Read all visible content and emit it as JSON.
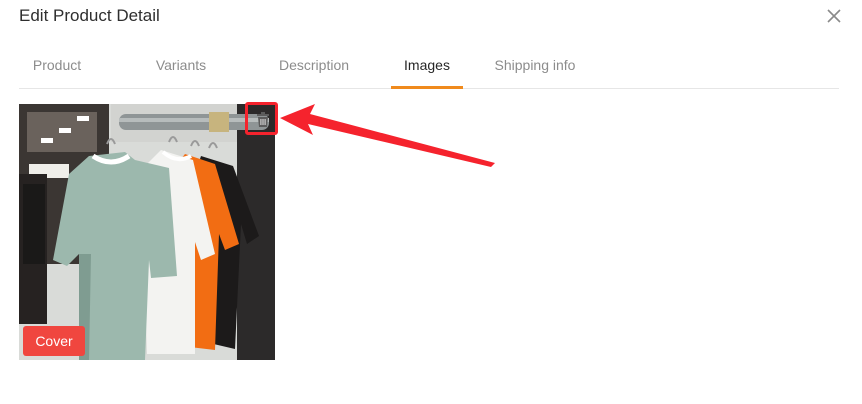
{
  "modal": {
    "title": "Edit Product Detail",
    "close_icon": "close-icon"
  },
  "tabs": [
    {
      "label": "Product",
      "active": false
    },
    {
      "label": "Variants",
      "active": false
    },
    {
      "label": "Description",
      "active": false
    },
    {
      "label": "Images",
      "active": true
    },
    {
      "label": "Shipping info",
      "active": false
    }
  ],
  "images": [
    {
      "description_icon": "product-photo",
      "badge": "Cover",
      "delete_icon": "trash-icon"
    }
  ],
  "colors": {
    "accent": "#f08a1c",
    "cover_badge": "#f0463f",
    "annotation": "#f5232d"
  }
}
